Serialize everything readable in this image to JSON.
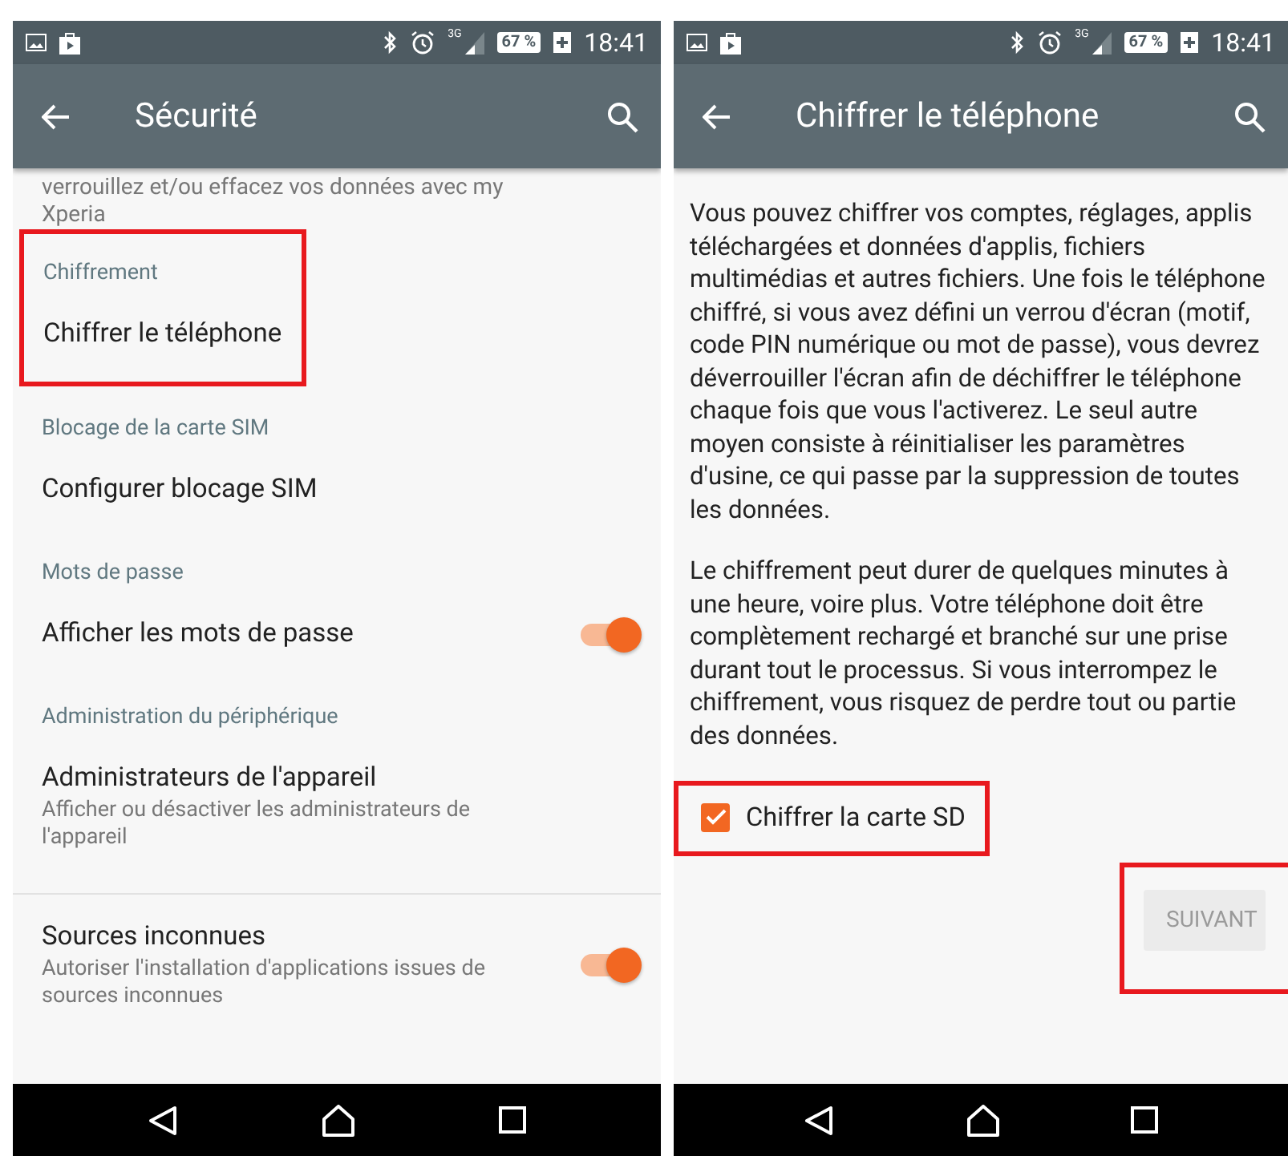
{
  "screens": [
    {
      "status_bar": {
        "network": "3G",
        "battery": "67 %",
        "time": "18:41"
      },
      "app_bar": {
        "title": "Sécurité"
      },
      "kind": "settings",
      "intro": "verrouillez et/ou effacez vos données avec my Xperia",
      "sections": [
        {
          "header": "Chiffrement",
          "highlighted": true,
          "items": [
            {
              "title": "Chiffrer le téléphone",
              "kind": "plain"
            }
          ]
        },
        {
          "header": "Blocage de la carte SIM",
          "highlighted": false,
          "items": [
            {
              "title": "Configurer blocage SIM",
              "kind": "plain"
            }
          ]
        },
        {
          "header": "Mots de passe",
          "highlighted": false,
          "items": [
            {
              "title": "Afficher les mots de passe",
              "kind": "toggle",
              "on": true
            }
          ]
        },
        {
          "header": "Administration du périphérique",
          "highlighted": false,
          "items": [
            {
              "title": "Administrateurs de l'appareil",
              "summary": "Afficher ou désactiver les administrateurs de l'appareil",
              "kind": "plain"
            }
          ]
        },
        {
          "highlighted": false,
          "items": [
            {
              "title": "Sources inconnues",
              "summary": "Autoriser l'installation d'applications issues de sources inconnues",
              "kind": "toggle",
              "on": true
            }
          ]
        }
      ]
    },
    {
      "status_bar": {
        "network": "3G",
        "battery": "67 %",
        "time": "18:41"
      },
      "app_bar": {
        "title": "Chiffrer le téléphone"
      },
      "kind": "encrypt",
      "paragraphs": [
        "Vous pouvez chiffrer vos comptes, réglages, applis téléchargées et données d'applis, fichiers multimédias et autres fichiers. Une fois le téléphone chiffré, si vous avez défini un verrou d'écran (motif, code PIN numérique ou mot de passe), vous devrez déverrouiller l'écran afin de déchiffrer le téléphone chaque fois que vous l'activerez. Le seul autre moyen consiste à réinitialiser les paramètres d'usine, ce qui passe par la suppression de toutes les données.",
        "Le chiffrement peut durer de quelques minutes à une heure, voire plus. Votre téléphone doit être complètement rechargé et branché sur une prise durant tout le processus. Si vous interrompez le chiffrement, vous risquez de perdre tout ou partie des données."
      ],
      "checkbox": {
        "label": "Chiffrer la carte SD",
        "checked": true,
        "highlighted": true
      },
      "button": {
        "label": "SUIVANT",
        "disabled": true,
        "highlighted": true
      }
    }
  ]
}
